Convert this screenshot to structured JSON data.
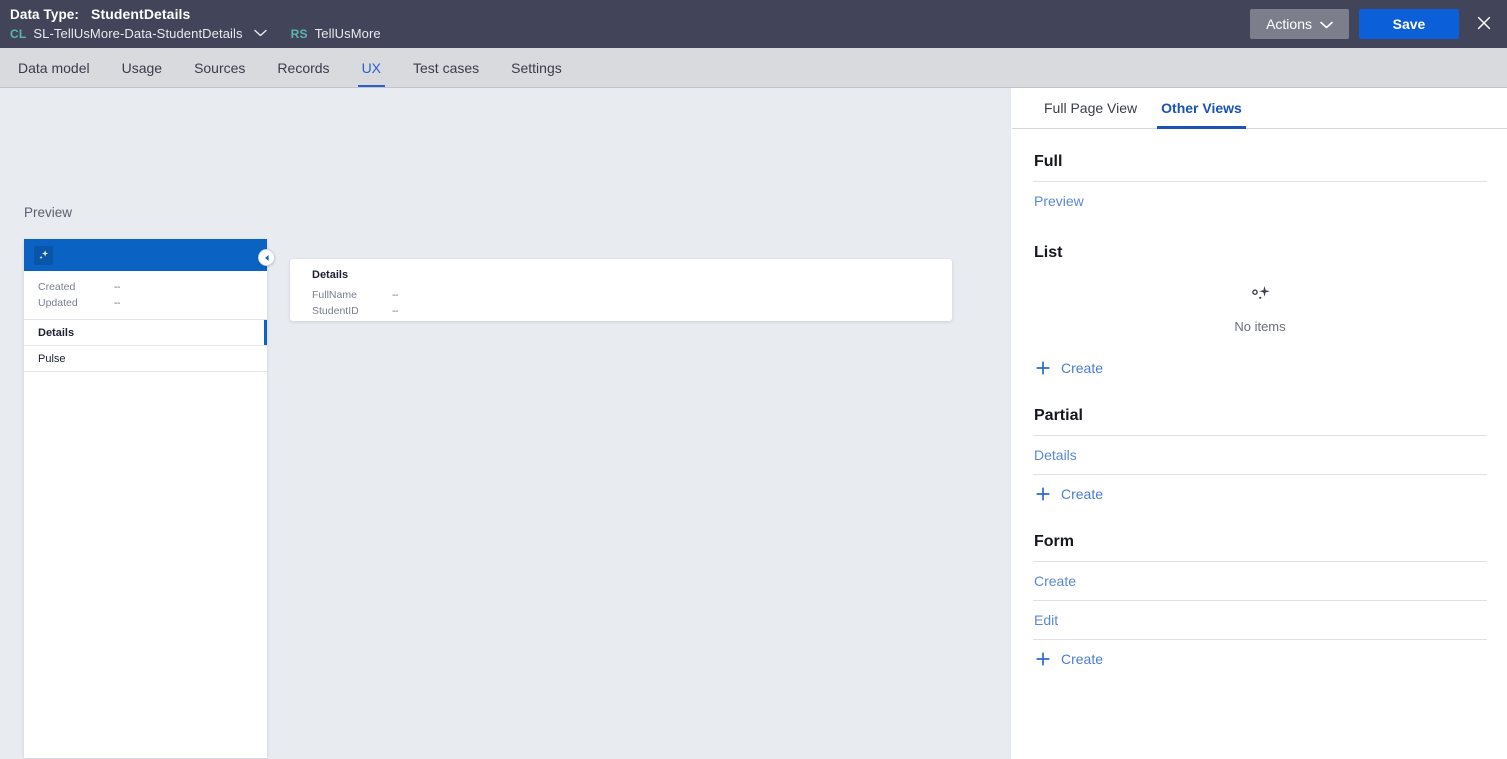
{
  "header": {
    "type_label": "Data Type:",
    "type_value": "StudentDetails",
    "class_badge": "CL",
    "class_name": "SL-TellUsMore-Data-StudentDetails",
    "ruleset_badge": "RS",
    "ruleset_name": "TellUsMore",
    "actions_label": "Actions",
    "save_label": "Save",
    "accent_dark": "#424559",
    "accent_blue": "#0b5fd9",
    "teal": "#5bb5b2"
  },
  "nav": {
    "tabs": [
      {
        "label": "Data model",
        "active": false
      },
      {
        "label": "Usage",
        "active": false
      },
      {
        "label": "Sources",
        "active": false
      },
      {
        "label": "Records",
        "active": false
      },
      {
        "label": "UX",
        "active": true
      },
      {
        "label": "Test cases",
        "active": false
      },
      {
        "label": "Settings",
        "active": false
      }
    ],
    "active_color": "#2a5fc9"
  },
  "preview": {
    "label": "Preview",
    "mock": {
      "sidebar": {
        "logo_icon": "sparkle-icon",
        "meta": [
          {
            "key": "Created",
            "value": "--"
          },
          {
            "key": "Updated",
            "value": "--"
          }
        ],
        "items": [
          {
            "label": "Details",
            "selected": true
          },
          {
            "label": "Pulse",
            "selected": false
          }
        ]
      },
      "collapse_icon": "chevron-left-icon",
      "card": {
        "title": "Details",
        "fields": [
          {
            "key": "FullName",
            "value": "--"
          },
          {
            "key": "StudentID",
            "value": "--"
          }
        ]
      }
    }
  },
  "side_panel": {
    "tabs": [
      {
        "label": "Full Page View",
        "active": false
      },
      {
        "label": "Other Views",
        "active": true
      }
    ],
    "sections": [
      {
        "title": "Full",
        "rows": [
          {
            "type": "link",
            "label": "Preview"
          }
        ]
      },
      {
        "title": "List",
        "empty": {
          "icon": "sparkle-icon",
          "text": "No items"
        },
        "rows": [
          {
            "type": "create",
            "label": "Create"
          }
        ]
      },
      {
        "title": "Partial",
        "rows": [
          {
            "type": "link",
            "label": "Details"
          },
          {
            "type": "create",
            "label": "Create"
          }
        ]
      },
      {
        "title": "Form",
        "rows": [
          {
            "type": "link",
            "label": "Create"
          },
          {
            "type": "link",
            "label": "Edit"
          },
          {
            "type": "create",
            "label": "Create"
          }
        ]
      }
    ]
  }
}
